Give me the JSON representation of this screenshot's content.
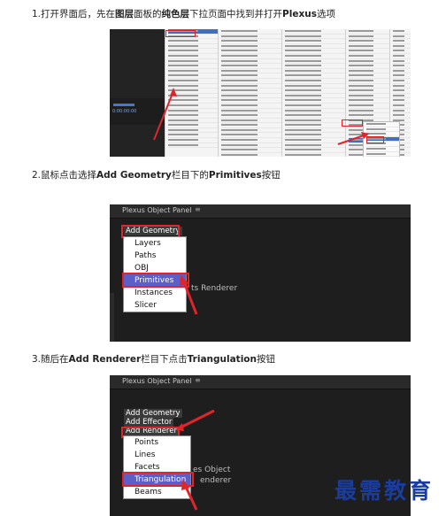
{
  "steps": [
    {
      "prefix": "1.打开界面后，先在",
      "b1": "图层",
      "mid1": "面板的",
      "b2": "纯色层",
      "mid2": "下拉页面中找到并打开",
      "b3": "Plexus",
      "suffix": "选项"
    },
    {
      "prefix": "2.鼠标点击选择",
      "b1": "Add Geometry",
      "mid1": "栏目下的",
      "b2": "Primitives",
      "suffix": "按钮"
    },
    {
      "prefix": "3.随后在",
      "b1": "Add Renderer",
      "mid1": "栏目下点击",
      "b2": "Triangulation",
      "suffix": "按钮"
    }
  ],
  "shot1": {
    "menu_visible_items": [
      "Effect",
      "Keyframe Assistant",
      "Track & Stabilize",
      "Open",
      "Reveal",
      "Create",
      "Camera",
      "Pre-compose...",
      "Invert Selection",
      "Select Children",
      "Rename"
    ],
    "shortcut": "Return",
    "plexus_label": "Plexus",
    "timeline_time": "0:00:00:00"
  },
  "shot2": {
    "panel_title": "Plexus Object Panel",
    "menu_icon": "≡",
    "header_item": "Add Geometry",
    "menu_items": [
      "Layers",
      "Paths",
      "OBJ",
      "Primitives",
      "Instances",
      "Slicer"
    ],
    "selected": "Primitives",
    "bg_text": "ts Renderer"
  },
  "shot3": {
    "panel_title": "Plexus Object Panel",
    "menu_icon": "≡",
    "top_items": [
      "Add Geometry",
      "Add Effector",
      "Add Renderer"
    ],
    "menu_items": [
      "Points",
      "Lines",
      "Facets",
      "Triangulation",
      "Beams"
    ],
    "selected": "Triangulation",
    "bg_text": [
      "es Object",
      "enderer"
    ]
  },
  "watermark": "最需教育",
  "colors": {
    "highlight": "#5b5fc7",
    "red": "#e0252a",
    "panel_bg": "#1e1e1e",
    "watermark": "#1a3c9c"
  }
}
